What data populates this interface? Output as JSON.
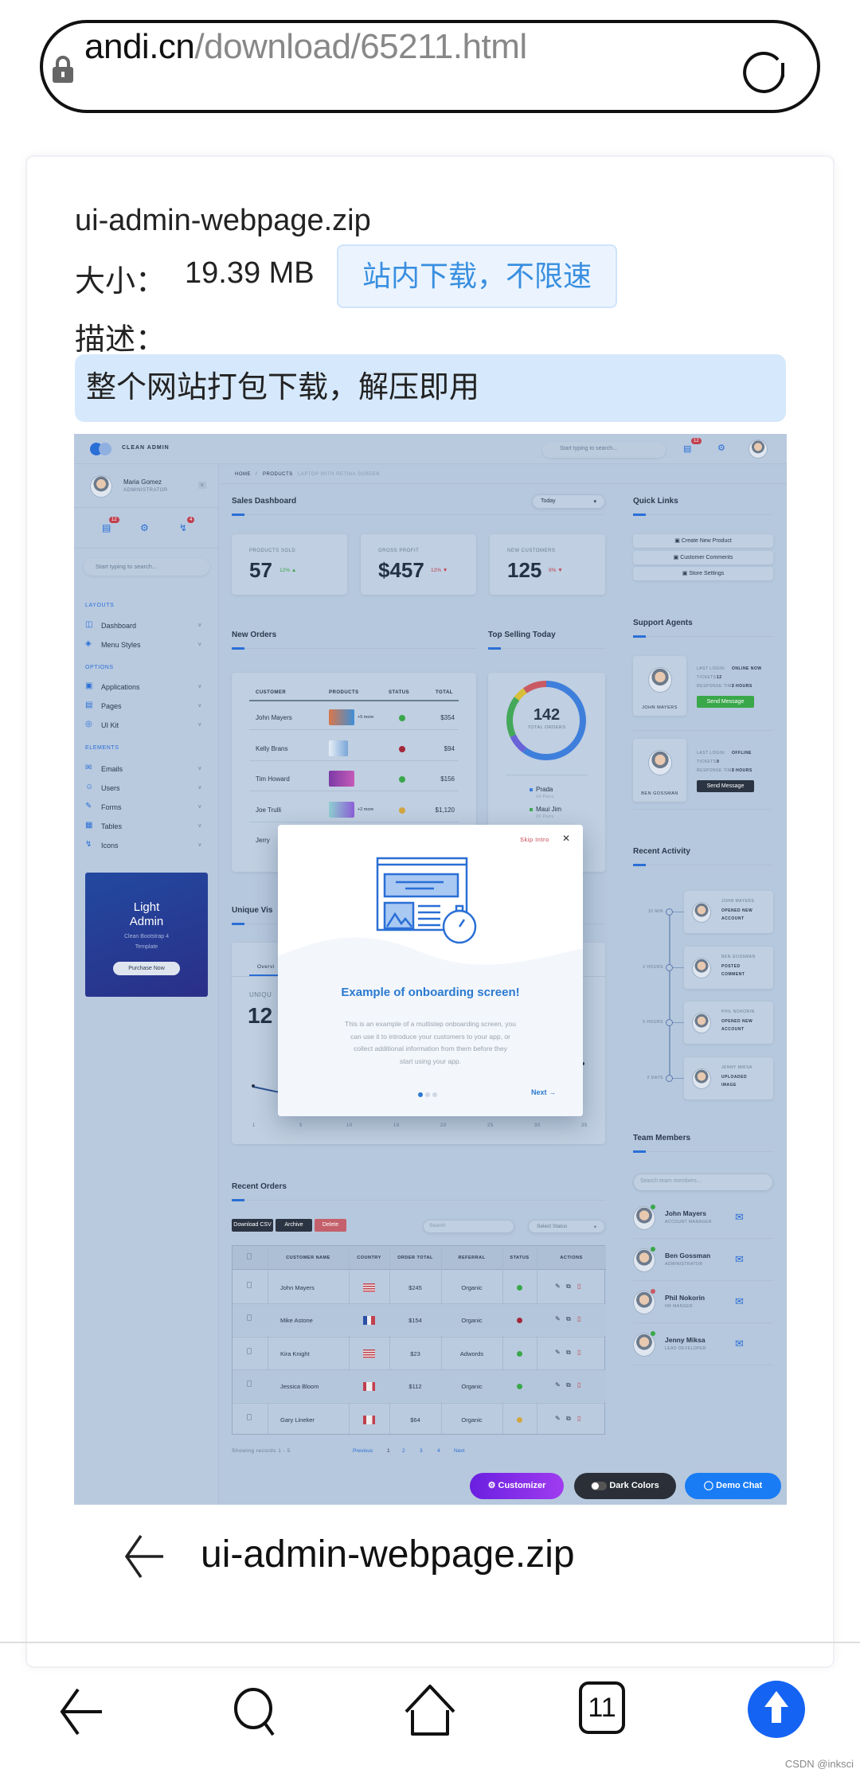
{
  "browser": {
    "url_host": "andi.cn",
    "url_path": "/download/65211.html"
  },
  "file": {
    "name": "ui-admin-webpage.zip",
    "size_label": "大小：",
    "size": "19.39 MB",
    "download_button": "站内下载，不限速",
    "desc_label": "描述：",
    "description": "整个网站打包下载，解压即用"
  },
  "preview": {
    "brand": "CLEAN ADMIN",
    "top_search": "Start typing to search...",
    "top_badge": "12",
    "user": {
      "name": "Maria Gomez",
      "role": "ADMINISTRATOR"
    },
    "side_badges": [
      "12",
      "4"
    ],
    "side_search": "Start typing to search...",
    "sections": [
      {
        "title": "LAYOUTS",
        "items": [
          "Dashboard",
          "Menu Styles"
        ]
      },
      {
        "title": "OPTIONS",
        "items": [
          "Applications",
          "Pages",
          "UI Kit"
        ]
      },
      {
        "title": "ELEMENTS",
        "items": [
          "Emails",
          "Users",
          "Forms",
          "Tables",
          "Icons"
        ]
      }
    ],
    "promo": {
      "title1": "Light",
      "title2": "Admin",
      "subtitle1": "Clean Bootstrap 4",
      "subtitle2": "Template",
      "button": "Purchase Now"
    },
    "breadcrumb": [
      "HOME",
      "PRODUCTS",
      "LAPTOP WITH RETINA SCREEN"
    ],
    "sales": {
      "title": "Sales Dashboard",
      "period": "Today",
      "stats": [
        {
          "label": "PRODUCTS SOLD",
          "value": "57",
          "change": "12% ▲",
          "color": "#3aa74a"
        },
        {
          "label": "GROSS PROFIT",
          "value": "$457",
          "change": "12% ▼",
          "color": "#c0404f"
        },
        {
          "label": "NEW CUSTOMERS",
          "value": "125",
          "change": "9% ▼",
          "color": "#c0404f"
        }
      ]
    },
    "quick_links": {
      "title": "Quick Links",
      "items": [
        "Create New Product",
        "Customer Comments",
        "Store Settings"
      ]
    },
    "new_orders": {
      "title": "New Orders",
      "columns": [
        "CUSTOMER",
        "PRODUCTS",
        "STATUS",
        "TOTAL"
      ],
      "rows": [
        {
          "customer": "John Mayers",
          "more": "+5 more",
          "status": "#3aa74a",
          "total": "$354"
        },
        {
          "customer": "Kelly Brans",
          "more": "",
          "status": "#a3283a",
          "total": "$94"
        },
        {
          "customer": "Tim Howard",
          "more": "",
          "status": "#3aa74a",
          "total": "$156"
        },
        {
          "customer": "Joe Trulli",
          "more": "+2 more",
          "status": "#d2a640",
          "total": "$1,120"
        },
        {
          "customer": "Jerry",
          "more": "",
          "status": "",
          "total": ""
        }
      ]
    },
    "top_selling": {
      "title": "Top Selling Today",
      "total": "142",
      "total_label": "TOTAL ORDERS",
      "segments": [
        {
          "pct": 60,
          "color": "#3f7fdc"
        },
        {
          "pct": 8,
          "color": "#6a62d8"
        },
        {
          "pct": 17,
          "color": "#43a85a"
        },
        {
          "pct": 5,
          "color": "#d8bd3a"
        },
        {
          "pct": 10,
          "color": "#c95a63"
        }
      ],
      "legend": [
        {
          "name": "Prada",
          "sub": "14 Pairs",
          "color": "#3f7fdc"
        },
        {
          "name": "Maui Jim",
          "sub": "26 Pairs",
          "color": "#43a85a"
        }
      ]
    },
    "support": {
      "title": "Support Agents",
      "agents": [
        {
          "name": "JOHN MAYERS",
          "login": "ONLINE NOW",
          "tickets": "12",
          "response": "2 HOURS",
          "button": "Send Message",
          "color": "#3aa74a"
        },
        {
          "name": "BEN GOSSMAN",
          "login": "OFFLINE",
          "tickets": "9",
          "response": "3 HOURS",
          "button": "Send Message",
          "color": "#2b3442"
        }
      ],
      "login_label": "LAST LOGIN:",
      "tickets_label": "TICKETS:",
      "response_label": "RESPONSE TIME:"
    },
    "activity": {
      "title": "Recent Activity",
      "items": [
        {
          "time": "10 MIN",
          "name": "JOHN MAYERS",
          "action1": "OPENED NEW",
          "action2": "ACCOUNT"
        },
        {
          "time": "2 HOURS",
          "name": "BEN GOSSMAN",
          "action1": "POSTED",
          "action2": "COMMENT"
        },
        {
          "time": "5 HOURS",
          "name": "PHIL NOKORIN",
          "action1": "OPENED NEW",
          "action2": "ACCOUNT"
        },
        {
          "time": "2 DAYS",
          "name": "JENNY MIKSA",
          "action1": "UPLOADED",
          "action2": "IMAGE"
        }
      ]
    },
    "team": {
      "title": "Team Members",
      "search": "Search team members...",
      "members": [
        {
          "name": "John Mayers",
          "role": "ACCOUNT MANAGER",
          "status": "#3aa74a"
        },
        {
          "name": "Ben Gossman",
          "role": "ADMINISTRATOR",
          "status": "#3aa74a"
        },
        {
          "name": "Phil Nokorin",
          "role": "HR MANGER",
          "status": "#c95a63"
        },
        {
          "name": "Jenny Miksa",
          "role": "LEAD DEVELOPER",
          "status": "#3aa74a"
        }
      ]
    },
    "visitors": {
      "title": "Unique Vis",
      "tab": "Overvi",
      "label": "UNIQU",
      "value": "12",
      "x_ticks": [
        "1",
        "5",
        "10",
        "15",
        "20",
        "25",
        "30",
        "35"
      ]
    },
    "modal": {
      "skip": "Skip Intro",
      "title": "Example of onboarding screen!",
      "text": [
        "This is an example of a multistep onboarding screen, you",
        "can use it to introduce your customers to your app, or",
        "collect additional information from them before they",
        "start using your app."
      ],
      "next": "Next",
      "step": 1,
      "steps": 3
    },
    "recent_orders": {
      "title": "Recent Orders",
      "buttons": [
        "Download CSV",
        "Archive",
        "Delete"
      ],
      "search": "Search",
      "status_select": "Select Status",
      "columns": [
        "",
        "CUSTOMER NAME",
        "COUNTRY",
        "ORDER TOTAL",
        "REFERRAL",
        "STATUS",
        "ACTIONS"
      ],
      "rows": [
        {
          "name": "John Mayers",
          "country": "us",
          "total": "$245",
          "referral": "Organic",
          "status": "#3aa74a"
        },
        {
          "name": "Mike Astone",
          "country": "fr",
          "total": "$154",
          "referral": "Organic",
          "status": "#a3283a"
        },
        {
          "name": "Kira Knight",
          "country": "us",
          "total": "$23",
          "referral": "Adwords",
          "status": "#3aa74a"
        },
        {
          "name": "Jessica Bloom",
          "country": "ca",
          "total": "$112",
          "referral": "Organic",
          "status": "#3aa74a"
        },
        {
          "name": "Gary Lineker",
          "country": "ca",
          "total": "$64",
          "referral": "Organic",
          "status": "#d2a640"
        }
      ],
      "showing": "Showing records 1 - 5",
      "pages": [
        "Previous",
        "1",
        "2",
        "3",
        "4",
        "Next"
      ]
    },
    "floating": [
      "Customizer",
      "Dark Colors",
      "Demo Chat"
    ]
  },
  "footer": {
    "back_filename": "ui-admin-webpage.zip"
  },
  "nav": {
    "tabs_count": "11"
  },
  "watermark": "CSDN @inksci"
}
